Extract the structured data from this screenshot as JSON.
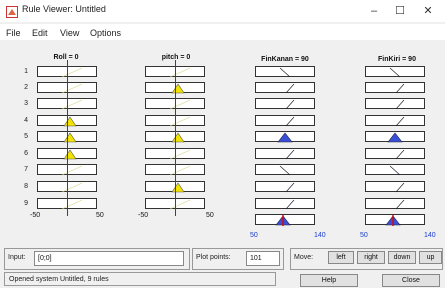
{
  "window": {
    "title": "Rule Viewer: Untitled",
    "controls": {
      "minimize": "–",
      "maximize": "☐",
      "close": "✕"
    }
  },
  "menu": {
    "items": [
      "File",
      "Edit",
      "View",
      "Options"
    ]
  },
  "inputs": [
    {
      "label": "Roll = 0",
      "range_min": "-50",
      "range_max": "50",
      "value": 0
    },
    {
      "label": "pitch = 0",
      "range_min": "-50",
      "range_max": "50",
      "value": 0
    }
  ],
  "outputs": [
    {
      "label": "FinKanan = 90",
      "range_min": "50",
      "range_max": "140",
      "value": 90
    },
    {
      "label": "FinKiri = 90",
      "range_min": "50",
      "range_max": "140",
      "value": 90
    }
  ],
  "rules": [
    "1",
    "2",
    "3",
    "4",
    "5",
    "6",
    "7",
    "8",
    "9"
  ],
  "bottom": {
    "input_label": "Input:",
    "input_value": "[0;0]",
    "plot_points_label": "Plot points:",
    "plot_points_value": "101",
    "move_label": "Move:",
    "move_buttons": [
      "left",
      "right",
      "down",
      "up"
    ],
    "help_label": "Help",
    "close_label": "Close",
    "status_text": "Opened system Untitled, 9 rules"
  },
  "colors": {
    "input_fill": "#f2e200",
    "output_fill": "#3a4fd6",
    "indicator": "#e00000",
    "axis_blue": "#1a3bcf"
  }
}
